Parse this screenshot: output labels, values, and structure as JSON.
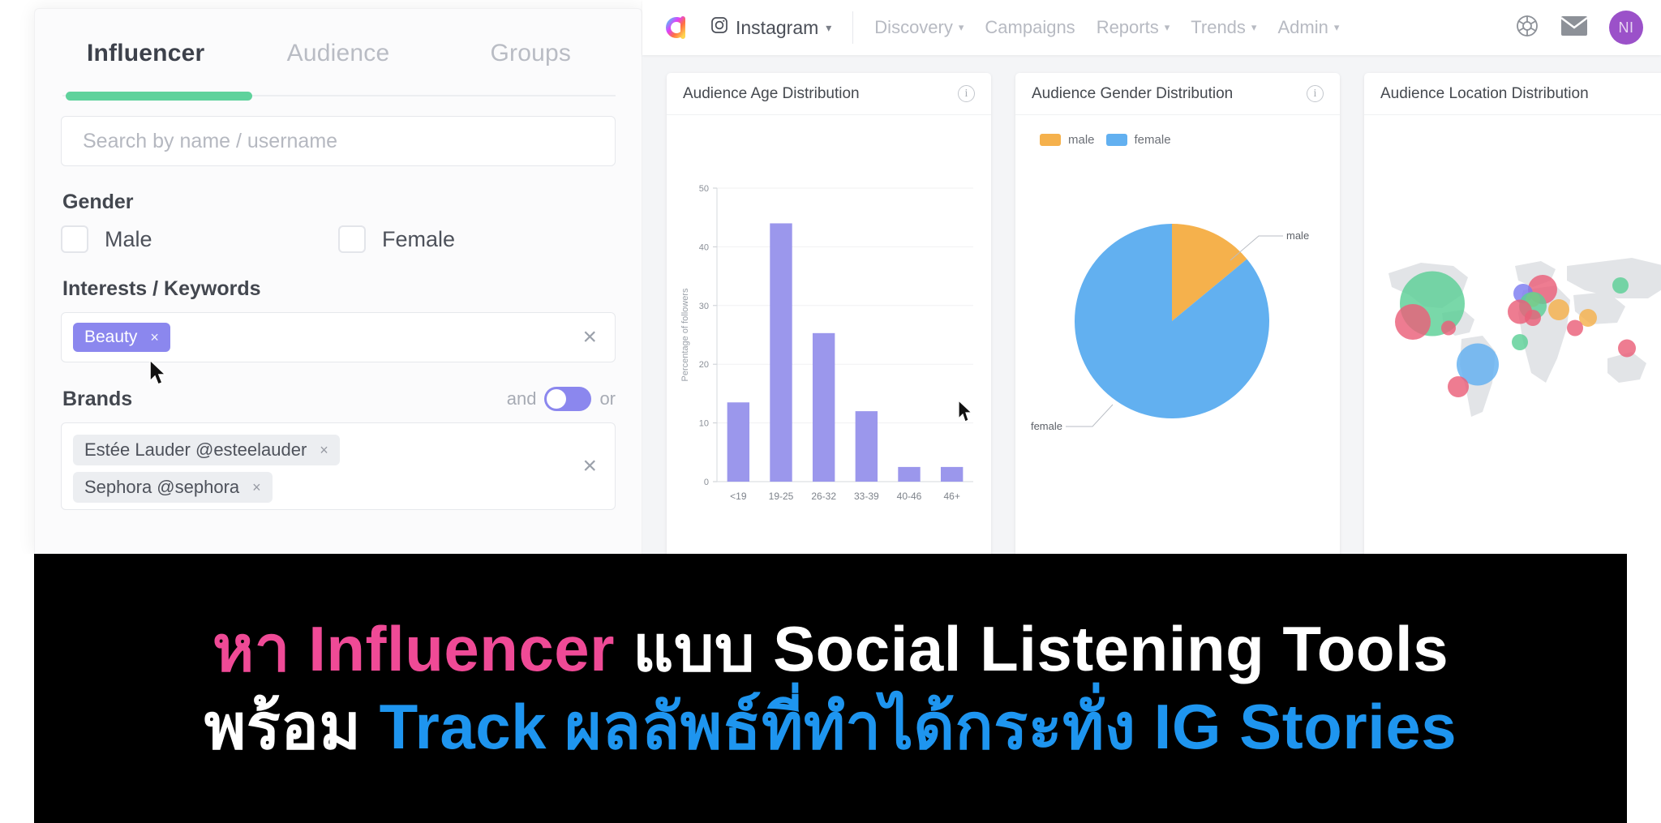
{
  "filter_panel": {
    "tabs": [
      {
        "label": "Influencer",
        "active": true
      },
      {
        "label": "Audience",
        "active": false
      },
      {
        "label": "Groups",
        "active": false
      }
    ],
    "search": {
      "placeholder": "Search by name / username",
      "value": ""
    },
    "gender": {
      "label": "Gender",
      "options": [
        {
          "label": "Male",
          "checked": false
        },
        {
          "label": "Female",
          "checked": false
        }
      ]
    },
    "interests": {
      "label": "Interests / Keywords",
      "chips": [
        {
          "label": "Beauty",
          "remove": "×"
        }
      ],
      "clear": "×"
    },
    "brands": {
      "label": "Brands",
      "and_label": "and",
      "or_label": "or",
      "toggle_state": "and",
      "chips": [
        {
          "label": "Estée Lauder @esteelauder",
          "remove": "×"
        },
        {
          "label": "Sephora @sephora",
          "remove": "×"
        }
      ],
      "clear": "×"
    },
    "accent_green": "#5fd29c",
    "chip_purple": "#8b87ee"
  },
  "topbar": {
    "platform": {
      "label": "Instagram",
      "caret": "▾"
    },
    "nav": [
      {
        "label": "Discovery",
        "caret": "▾"
      },
      {
        "label": "Campaigns",
        "caret": ""
      },
      {
        "label": "Reports",
        "caret": "▾"
      },
      {
        "label": "Trends",
        "caret": "▾"
      },
      {
        "label": "Admin",
        "caret": "▾"
      }
    ],
    "icons": [
      {
        "name": "aperture-icon"
      },
      {
        "name": "mail-icon"
      }
    ],
    "avatar": {
      "initials": "NI",
      "color": "#9b51c9"
    }
  },
  "cards": [
    {
      "title": "Audience Age Distribution",
      "info": "i"
    },
    {
      "title": "Audience Gender Distribution",
      "info": "i"
    },
    {
      "title": "Audience Location Distribution",
      "info": ""
    }
  ],
  "chart_data": [
    {
      "type": "bar",
      "title": "Audience Age Distribution",
      "categories": [
        "<19",
        "19-25",
        "26-32",
        "33-39",
        "40-46",
        "46+"
      ],
      "values": [
        13.5,
        44.0,
        25.3,
        12.0,
        2.5,
        2.5
      ],
      "xlabel": "",
      "ylabel": "Percentage of followers",
      "ylim": [
        0,
        50
      ],
      "yticks": [
        0,
        10,
        20,
        30,
        40,
        50
      ],
      "grid": true,
      "legend": "none",
      "bar_color": "#9b97ec"
    },
    {
      "type": "pie",
      "title": "Audience Gender Distribution",
      "labels": [
        "male",
        "female"
      ],
      "values": [
        14,
        86
      ],
      "colors": [
        "#f5b councils",
        "#f5b14c"
      ],
      "slice_colors": [
        "#f5b14c",
        "#62b0f0"
      ],
      "legend": [
        "male",
        "female"
      ],
      "legend_position": "top-left",
      "annotations": [
        "male",
        "female"
      ]
    },
    {
      "type": "scatter",
      "title": "Audience Location Distribution",
      "subtype": "bubble-map",
      "bubbles": [
        {
          "x": 21,
          "y": 33,
          "r": 40,
          "color": "#5ccf96"
        },
        {
          "x": 15,
          "y": 42,
          "r": 22,
          "color": "#ea5f79"
        },
        {
          "x": 26,
          "y": 45,
          "r": 9,
          "color": "#ea5f79"
        },
        {
          "x": 55,
          "y": 26,
          "r": 18,
          "color": "#ea5f79"
        },
        {
          "x": 49,
          "y": 28,
          "r": 12,
          "color": "#7b7bf0"
        },
        {
          "x": 52,
          "y": 31,
          "r": 9,
          "color": "#f5b14c"
        },
        {
          "x": 52,
          "y": 34,
          "r": 17,
          "color": "#5ccf96"
        },
        {
          "x": 48,
          "y": 37,
          "r": 15,
          "color": "#ea5f79"
        },
        {
          "x": 52,
          "y": 40,
          "r": 10,
          "color": "#ea5f79"
        },
        {
          "x": 60,
          "y": 36,
          "r": 13,
          "color": "#f5b14c"
        },
        {
          "x": 69,
          "y": 40,
          "r": 11,
          "color": "#f5b14c"
        },
        {
          "x": 65,
          "y": 45,
          "r": 10,
          "color": "#ea5f79"
        },
        {
          "x": 79,
          "y": 24,
          "r": 10,
          "color": "#5ccf96"
        },
        {
          "x": 48,
          "y": 52,
          "r": 10,
          "color": "#5ccf96"
        },
        {
          "x": 35,
          "y": 63,
          "r": 26,
          "color": "#62b0f0"
        },
        {
          "x": 29,
          "y": 74,
          "r": 13,
          "color": "#ea5f79"
        },
        {
          "x": 81,
          "y": 55,
          "r": 11,
          "color": "#ea5f79"
        }
      ]
    }
  ],
  "banner": {
    "line1": [
      {
        "text": "หา Influencer",
        "color": "pink"
      },
      {
        "text": "แบบ Social Listening Tools",
        "color": "white"
      }
    ],
    "line2": [
      {
        "text": "พร้อม",
        "color": "white"
      },
      {
        "text": "Track ผลลัพธ์ที่ทำได้กระทั่ง IG Stories",
        "color": "blue"
      }
    ],
    "colors": {
      "pink": "#ef4a96",
      "white": "#ffffff",
      "blue": "#1e95ef",
      "background": "#000000"
    }
  }
}
